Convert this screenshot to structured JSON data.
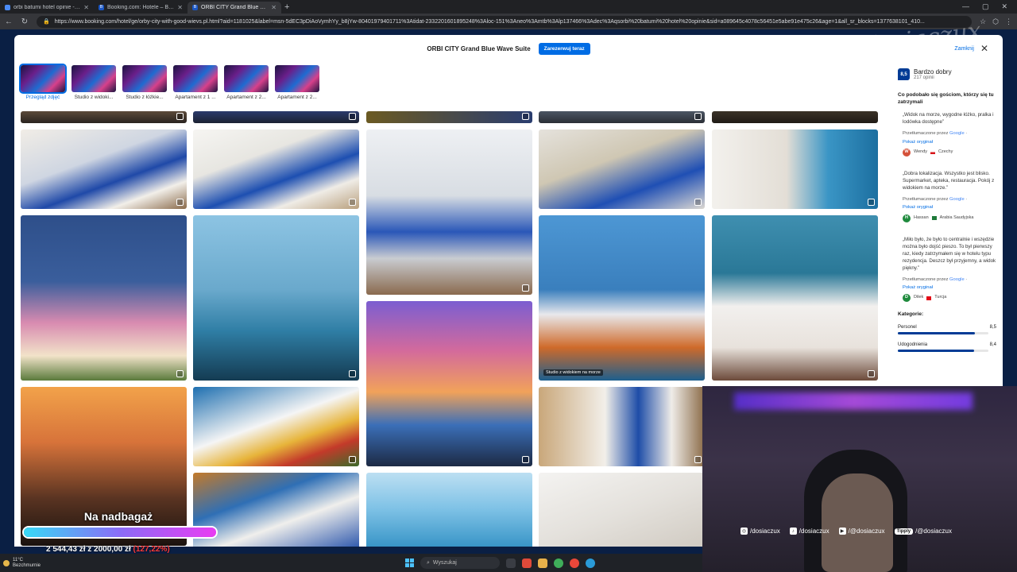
{
  "browser": {
    "tabs": [
      {
        "label": "orbi batumi hotel opinie - Wyszukaj"
      },
      {
        "label": "Booking.com: Hotele – Batumi. Z..."
      },
      {
        "label": "ORBI CITY Grand Blue Wave Suite"
      }
    ],
    "url": "https://www.booking.com/hotel/ge/orby-city-with-good-wievs.pl.html?aid=1181025&label=msn-5dEC3pDiAoVymhYy_b8jYw-80401979401711%3Atidat-2332201601895248%3Aloc-151%3Aneo%3Amtb%3Alp137466%3Adec%3Aqsorbi%20batumi%20hotel%20opinie&sid=a089645c4078c56451e5abe91e475c26&age=1&all_sr_blocks=1377638101_410..."
  },
  "modal": {
    "title": "ORBI CITY Grand Blue Wave Suite",
    "reserve_label": "Zarezerwuj teraz",
    "close_label": "Zamknij",
    "thumbs": [
      {
        "label": "Przegląd zdjęć"
      },
      {
        "label": "Studio z widoki..."
      },
      {
        "label": "Studio z łóżkie..."
      },
      {
        "label": "Apartament z 1 ..."
      },
      {
        "label": "Apartament z 2..."
      },
      {
        "label": "Apartament z 2..."
      }
    ],
    "photo_caption": "Studio z widokiem na morze"
  },
  "sidebar": {
    "score": "8,5",
    "rating_word": "Bardzo dobry",
    "review_count": "217 opinii",
    "heading": "Co podobało się gościom, którzy się tu zatrzymali",
    "translated_by": "Przetłumaczone przez",
    "google": "Google",
    "show_original": "Pokaż oryginał",
    "reviews": [
      {
        "quote": "„Widok na morze, wygodne łóżko, pralka i lodówka dostępne”",
        "initial": "W",
        "name": "Wendy",
        "country": "Czechy",
        "avatar_color": "#d4513a"
      },
      {
        "quote": "„Dobra lokalizacja. Wszystko jest blisko. Supermarket, apteka, restauracja. Pokój z widokiem na morze.”",
        "initial": "H",
        "name": "Hassan",
        "country": "Arabia Saudyjska",
        "avatar_color": "#1f8a3d"
      },
      {
        "quote": "„Miło było, że było to centralnie i wszędzie można było dojść pieszo. To był pierwszy raz, kiedy zatrzymałem się w hotelu typu rezydencja. Deszcz był przyjemny, a widok piękny.”",
        "initial": "D",
        "name": "Dilek",
        "country": "Turcja",
        "avatar_color": "#1f8a3d"
      }
    ],
    "categories_label": "Kategorie:",
    "categories": [
      {
        "name": "Personel",
        "score": "8,5",
        "fraction": 0.85
      },
      {
        "name": "Udogodnienia",
        "score": "8,4",
        "fraction": 0.84
      }
    ]
  },
  "stream": {
    "goal_title": "Na nadbagaż",
    "goal_amount": "2 544,43 zł z 2000,00 zł",
    "goal_percent": "(127,22%)",
    "goal_fraction": 1.0,
    "watermark": "dosiaczux",
    "socials": [
      {
        "icon": "instagram-icon",
        "handle": "/dosiaczux"
      },
      {
        "icon": "tiktok-icon",
        "handle": "/dosiaczux"
      },
      {
        "icon": "youtube-icon",
        "handle": "/@dosiaczux"
      }
    ],
    "tipply_label": "Tipply",
    "tipply_handle": "/@dosiaczux"
  },
  "taskbar": {
    "temperature": "11°C",
    "weather": "Bezchmurnie",
    "search_placeholder": "Wyszukaj"
  }
}
